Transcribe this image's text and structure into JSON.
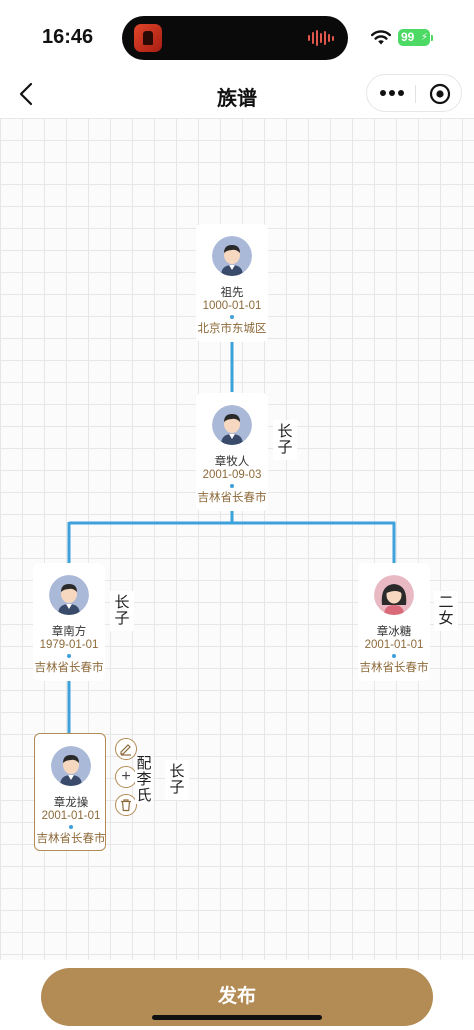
{
  "status_bar": {
    "time": "16:46",
    "battery": "99"
  },
  "nav": {
    "title": "族谱"
  },
  "tree": {
    "ancestor": {
      "name": "祖先",
      "date": "1000-01-01",
      "place": "北京市东城区"
    },
    "zhang_muren": {
      "name": "章牧人",
      "date": "2001-09-03",
      "place": "吉林省长春市",
      "relation": "长子"
    },
    "zhang_nanfang": {
      "name": "章南方",
      "date": "1979-01-01",
      "place": "吉林省长春市",
      "relation": "长子"
    },
    "zhang_bingtang": {
      "name": "章冰糖",
      "date": "2001-01-01",
      "place": "吉林省长春市",
      "relation": "二女"
    },
    "zhang_longcao": {
      "name": "章龙操",
      "date": "2001-01-01",
      "place": "吉林省长春市",
      "relation": "长子",
      "spouse": "配李氏"
    }
  },
  "actions": {
    "edit": "✎",
    "add": "+",
    "delete": "🗑"
  },
  "footer": {
    "publish_label": "发布"
  },
  "colors": {
    "accent": "#b38b55",
    "connector": "#3da1dc",
    "date_text": "#8d6a3a"
  }
}
